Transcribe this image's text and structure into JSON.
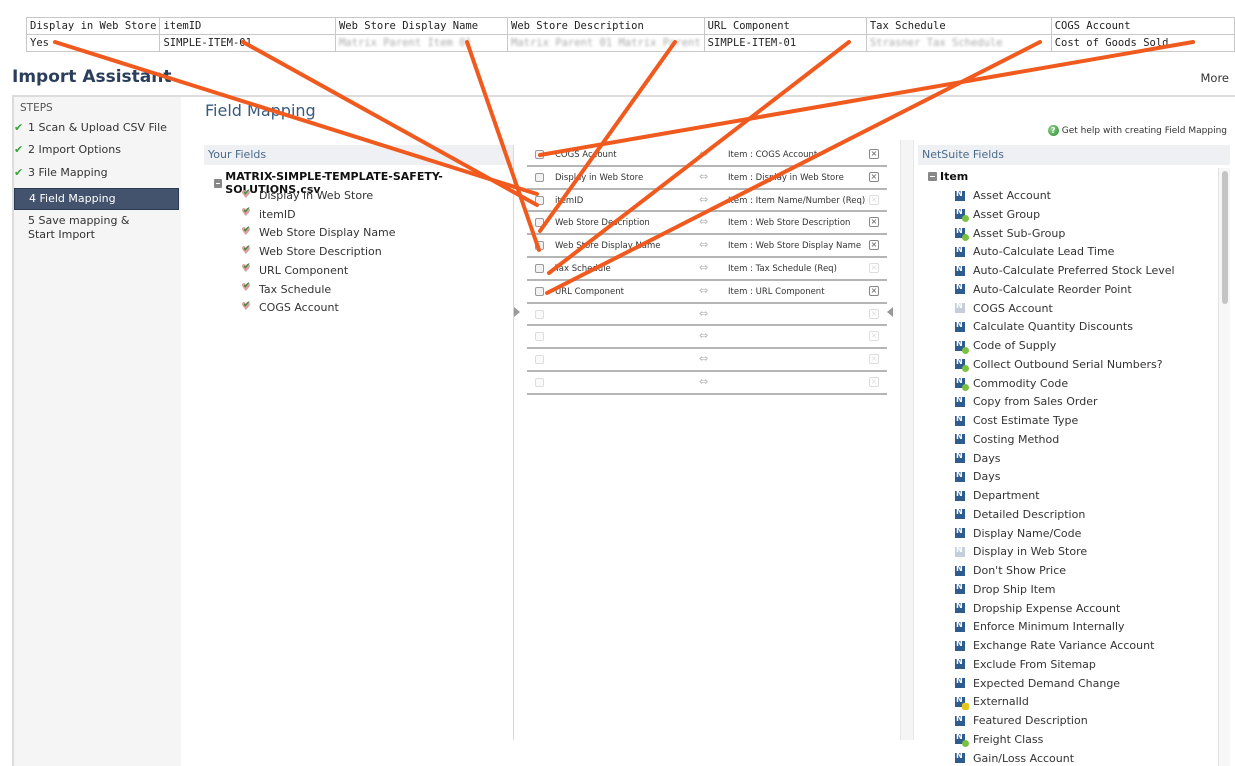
{
  "csv_preview": {
    "headers": [
      "Display in Web Store",
      "itemID",
      "Web Store Display Name",
      "Web Store Description",
      "URL Component",
      "Tax Schedule",
      "COGS Account"
    ],
    "row": [
      "Yes",
      "SIMPLE-ITEM-01",
      "Matrix Parent Item 01",
      "Matrix Parent 01 Matrix Parent",
      "SIMPLE-ITEM-01",
      "Strasner Tax Schedule",
      "Cost of Goods Sold"
    ],
    "blurred_columns": [
      2,
      3,
      5
    ]
  },
  "header": {
    "title": "Import Assistant",
    "more_label": "More"
  },
  "steps": {
    "label": "STEPS",
    "items": [
      {
        "label": "1 Scan & Upload CSV File",
        "done": true
      },
      {
        "label": "2 Import Options",
        "done": true
      },
      {
        "label": "3 File Mapping",
        "done": true
      },
      {
        "label": "4 Field Mapping",
        "active": true
      },
      {
        "label": "5 Save mapping & Start Import"
      }
    ]
  },
  "main": {
    "title": "Field Mapping",
    "help_link": "Get help with creating Field Mapping"
  },
  "your_fields": {
    "header": "Your Fields",
    "file_name": "MATRIX-SIMPLE-TEMPLATE-SAFETY-SOLUTIONS.csv",
    "fields": [
      "Display in Web Store",
      "itemID",
      "Web Store Display Name",
      "Web Store Description",
      "URL Component",
      "Tax Schedule",
      "COGS Account"
    ]
  },
  "mappings": [
    {
      "source": "COGS Account",
      "target": "Item : COGS Account",
      "removable": true
    },
    {
      "source": "Display in Web Store",
      "target": "Item : Display in Web Store",
      "removable": true
    },
    {
      "source": "itemID",
      "target": "Item : Item Name/Number (Req)",
      "removable": false
    },
    {
      "source": "Web Store Description",
      "target": "Item : Web Store Description",
      "removable": true
    },
    {
      "source": "Web Store Display Name",
      "target": "Item : Web Store Display Name",
      "removable": true
    },
    {
      "source": "Tax Schedule",
      "target": "Item : Tax Schedule (Req)",
      "removable": false
    },
    {
      "source": "URL Component",
      "target": "Item : URL Component",
      "removable": true
    },
    {
      "source": "",
      "target": "",
      "removable": false
    },
    {
      "source": "",
      "target": "",
      "removable": false
    },
    {
      "source": "",
      "target": "",
      "removable": false
    },
    {
      "source": "",
      "target": "",
      "removable": false
    }
  ],
  "arrow_glyph": "⇔",
  "netsuite_fields": {
    "header": "NetSuite Fields",
    "root": "Item",
    "fields": [
      {
        "label": "Asset Account"
      },
      {
        "label": "Asset Group",
        "badge": "list"
      },
      {
        "label": "Asset Sub-Group",
        "badge": "list"
      },
      {
        "label": "Auto-Calculate Lead Time"
      },
      {
        "label": "Auto-Calculate Preferred Stock Level"
      },
      {
        "label": "Auto-Calculate Reorder Point"
      },
      {
        "label": "COGS Account",
        "mapped": true
      },
      {
        "label": "Calculate Quantity Discounts"
      },
      {
        "label": "Code of Supply",
        "badge": "list"
      },
      {
        "label": "Collect Outbound Serial Numbers?",
        "badge": "list"
      },
      {
        "label": "Commodity Code",
        "badge": "list"
      },
      {
        "label": "Copy from Sales Order"
      },
      {
        "label": "Cost Estimate Type"
      },
      {
        "label": "Costing Method"
      },
      {
        "label": "Days"
      },
      {
        "label": "Days"
      },
      {
        "label": "Department"
      },
      {
        "label": "Detailed Description"
      },
      {
        "label": "Display Name/Code"
      },
      {
        "label": "Display in Web Store",
        "mapped": true
      },
      {
        "label": "Don't Show Price"
      },
      {
        "label": "Drop Ship Item"
      },
      {
        "label": "Dropship Expense Account"
      },
      {
        "label": "Enforce Minimum Internally"
      },
      {
        "label": "Exchange Rate Variance Account"
      },
      {
        "label": "Exclude From Sitemap"
      },
      {
        "label": "Expected Demand Change"
      },
      {
        "label": "ExternalId",
        "badge": "key"
      },
      {
        "label": "Featured Description"
      },
      {
        "label": "Freight Class",
        "badge": "list"
      },
      {
        "label": "Gain/Loss Account"
      }
    ]
  },
  "colors": {
    "annotation": "#f05a1e",
    "active_step": "#44536d",
    "title": "#2b3f5c",
    "check": "#3aa33a"
  }
}
